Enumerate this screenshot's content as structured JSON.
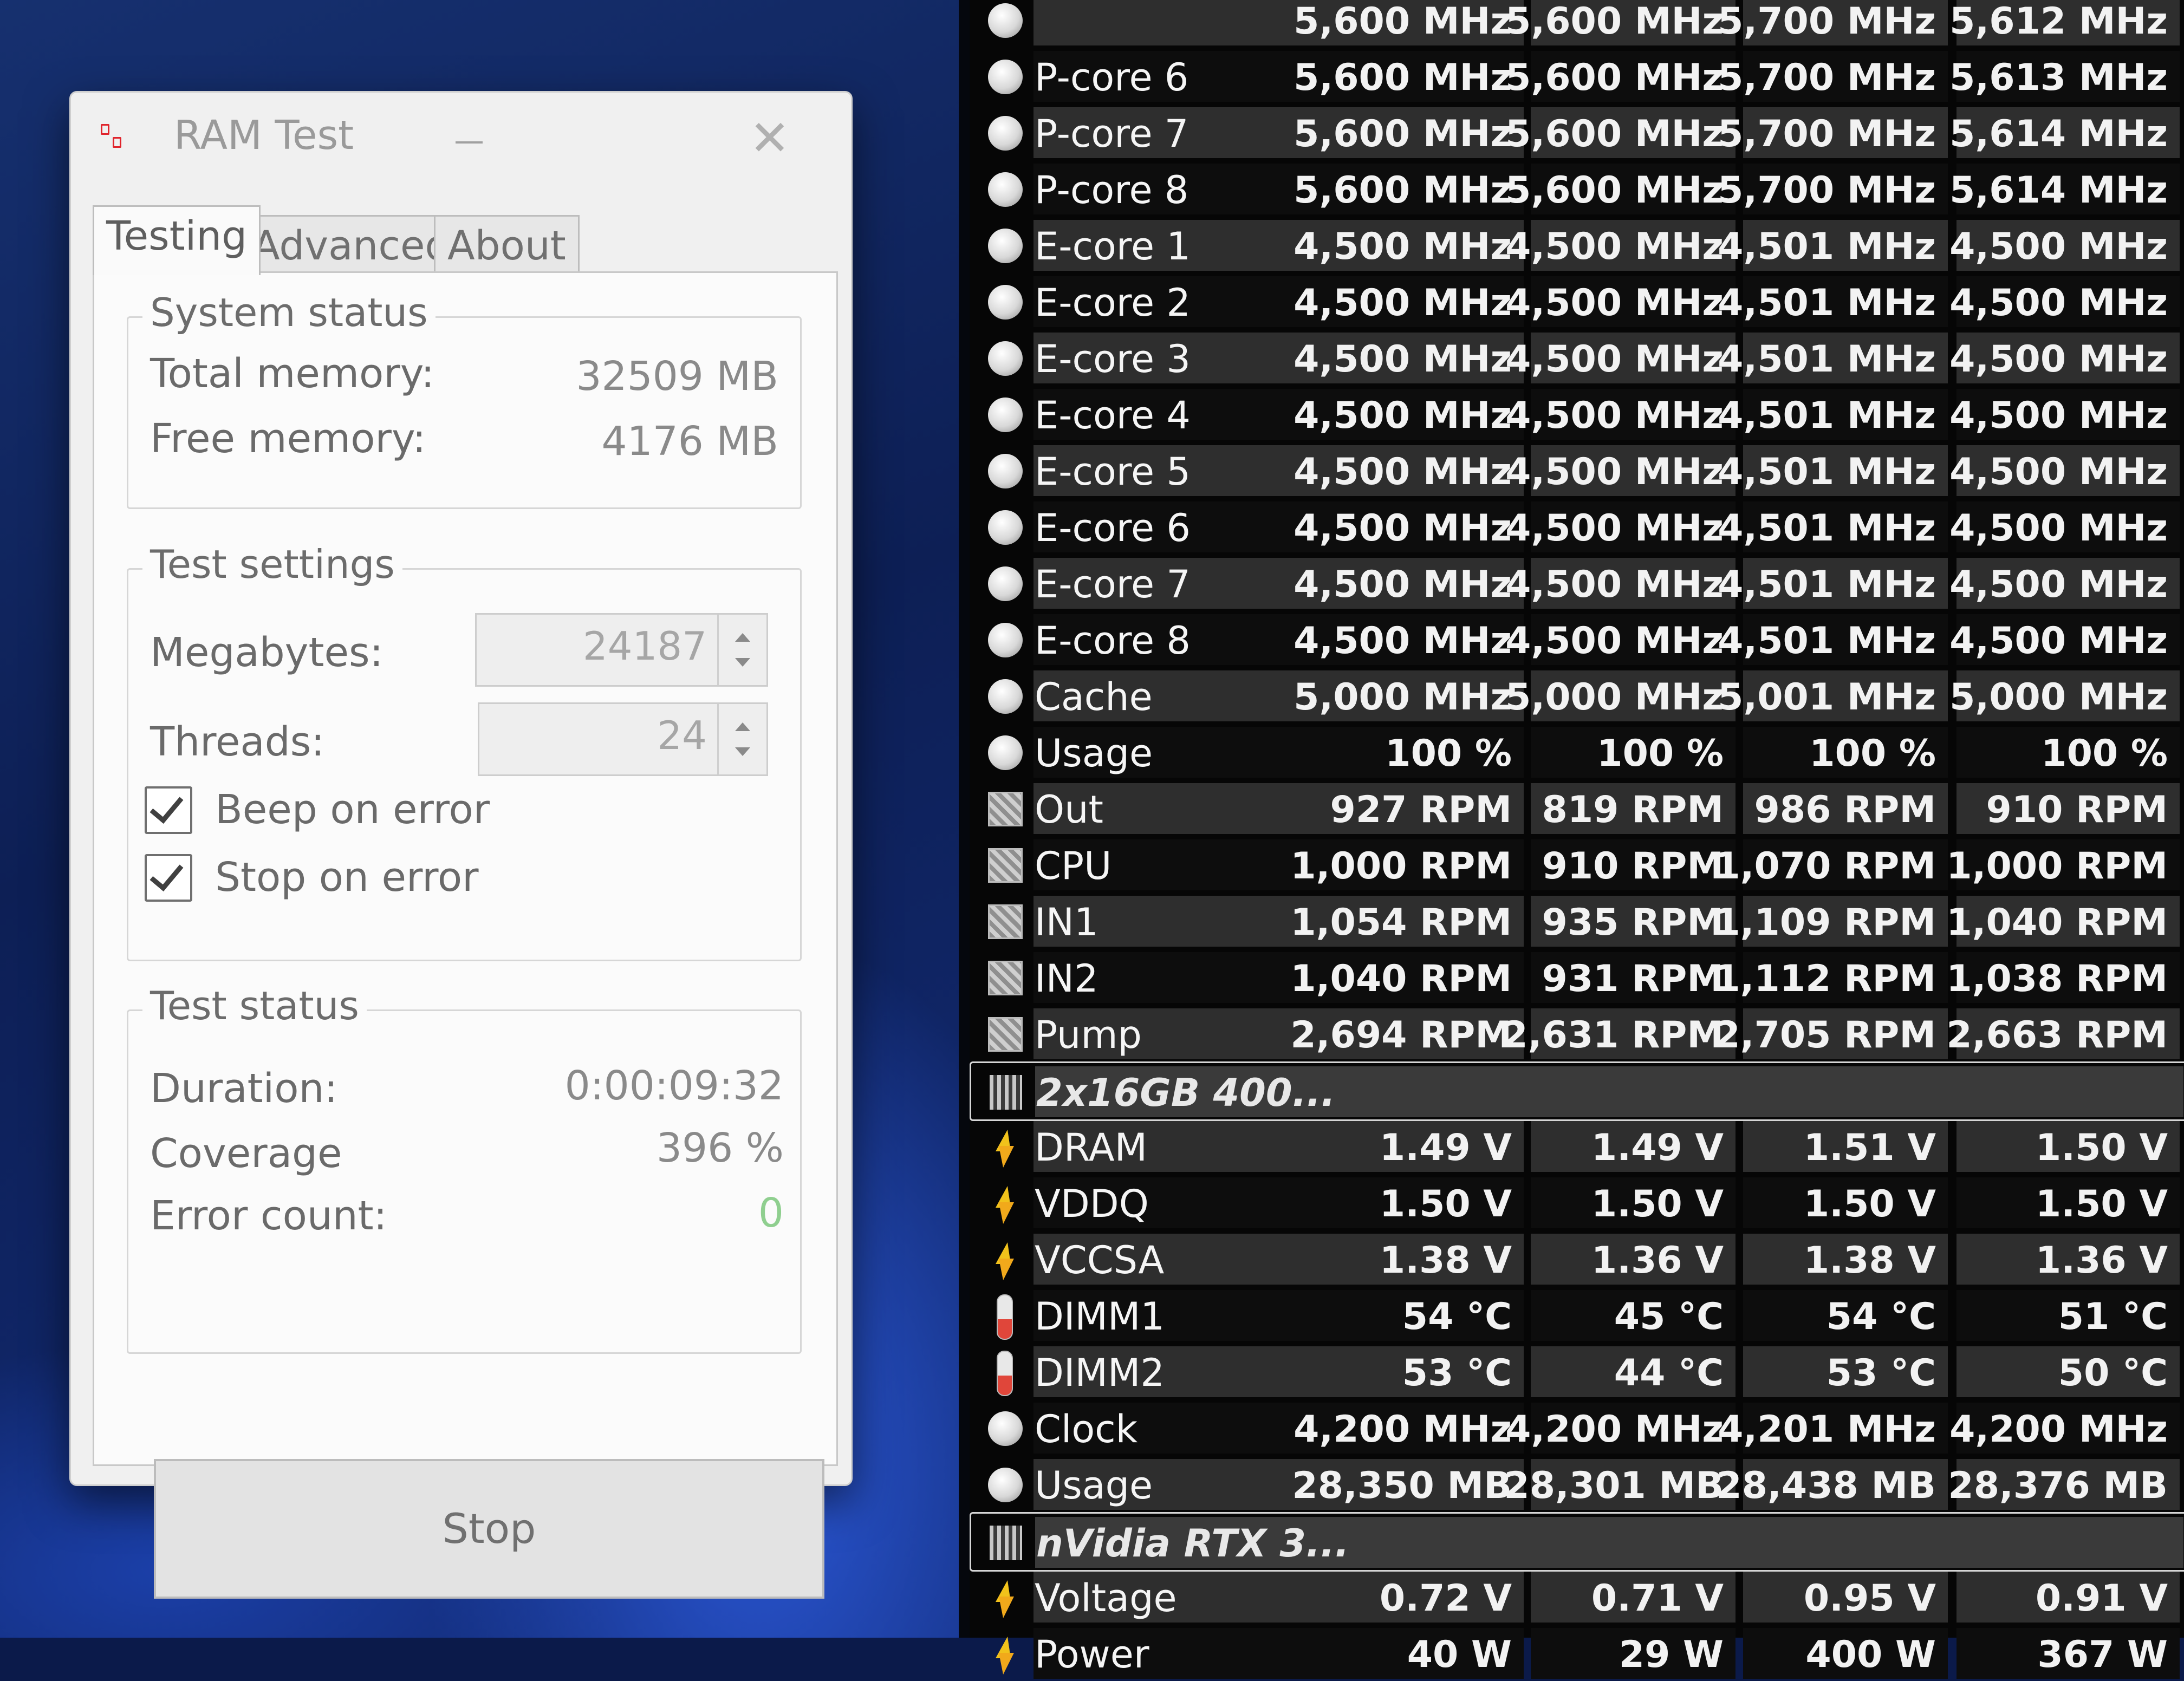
{
  "ramtest": {
    "title": "RAM Test",
    "close_glyph": "✕",
    "tabs": [
      "Testing",
      "Advanced",
      "About"
    ],
    "system_status": {
      "title": "System status",
      "total_label": "Total memory:",
      "total_value": "32509 MB",
      "free_label": "Free memory:",
      "free_value": "4176 MB"
    },
    "test_settings": {
      "title": "Test settings",
      "megabytes_label": "Megabytes:",
      "megabytes_value": "24187",
      "threads_label": "Threads:",
      "threads_value": "24",
      "beep_label": "Beep on error",
      "beep_checked": true,
      "stop_label": "Stop on error",
      "stop_checked": true
    },
    "test_status": {
      "title": "Test status",
      "duration_label": "Duration:",
      "duration_value": "0:00:09:32",
      "coverage_label": "Coverage",
      "coverage_value": "396 %",
      "errors_label": "Error count:",
      "errors_value": "0"
    },
    "stop_button": "Stop",
    "colors": {
      "error_count": "#8fcf8f",
      "close_icon": "#b0b0b0",
      "app_icon": "#e0242c"
    }
  },
  "sensors": {
    "rows": [
      {
        "name": "",
        "icon": "round-icon",
        "v": [
          "5,600 MHz",
          "5,600 MHz",
          "5,700 MHz",
          "5,612 MHz"
        ]
      },
      {
        "name": "P-core 6",
        "icon": "round-icon",
        "v": [
          "5,600 MHz",
          "5,600 MHz",
          "5,700 MHz",
          "5,613 MHz"
        ]
      },
      {
        "name": "P-core 7",
        "icon": "round-icon",
        "v": [
          "5,600 MHz",
          "5,600 MHz",
          "5,700 MHz",
          "5,614 MHz"
        ]
      },
      {
        "name": "P-core 8",
        "icon": "round-icon",
        "v": [
          "5,600 MHz",
          "5,600 MHz",
          "5,700 MHz",
          "5,614 MHz"
        ]
      },
      {
        "name": "E-core 1",
        "icon": "round-icon",
        "v": [
          "4,500 MHz",
          "4,500 MHz",
          "4,501 MHz",
          "4,500 MHz"
        ]
      },
      {
        "name": "E-core 2",
        "icon": "round-icon",
        "v": [
          "4,500 MHz",
          "4,500 MHz",
          "4,501 MHz",
          "4,500 MHz"
        ]
      },
      {
        "name": "E-core 3",
        "icon": "round-icon",
        "v": [
          "4,500 MHz",
          "4,500 MHz",
          "4,501 MHz",
          "4,500 MHz"
        ]
      },
      {
        "name": "E-core 4",
        "icon": "round-icon",
        "v": [
          "4,500 MHz",
          "4,500 MHz",
          "4,501 MHz",
          "4,500 MHz"
        ]
      },
      {
        "name": "E-core 5",
        "icon": "round-icon",
        "v": [
          "4,500 MHz",
          "4,500 MHz",
          "4,501 MHz",
          "4,500 MHz"
        ]
      },
      {
        "name": "E-core 6",
        "icon": "round-icon",
        "v": [
          "4,500 MHz",
          "4,500 MHz",
          "4,501 MHz",
          "4,500 MHz"
        ]
      },
      {
        "name": "E-core 7",
        "icon": "round-icon",
        "v": [
          "4,500 MHz",
          "4,500 MHz",
          "4,501 MHz",
          "4,500 MHz"
        ]
      },
      {
        "name": "E-core 8",
        "icon": "round-icon",
        "v": [
          "4,500 MHz",
          "4,500 MHz",
          "4,501 MHz",
          "4,500 MHz"
        ]
      },
      {
        "name": "Cache",
        "icon": "round-icon",
        "v": [
          "5,000 MHz",
          "5,000 MHz",
          "5,001 MHz",
          "5,000 MHz"
        ]
      },
      {
        "name": "Usage",
        "icon": "round-icon",
        "v": [
          "100 %",
          "100 %",
          "100 %",
          "100 %"
        ]
      },
      {
        "name": "Out",
        "icon": "fan-icon",
        "v": [
          "927 RPM",
          "819 RPM",
          "986 RPM",
          "910 RPM"
        ]
      },
      {
        "name": "CPU",
        "icon": "fan-icon",
        "v": [
          "1,000 RPM",
          "910 RPM",
          "1,070 RPM",
          "1,000 RPM"
        ]
      },
      {
        "name": "IN1",
        "icon": "fan-icon",
        "v": [
          "1,054 RPM",
          "935 RPM",
          "1,109 RPM",
          "1,040 RPM"
        ]
      },
      {
        "name": "IN2",
        "icon": "fan-icon",
        "v": [
          "1,040 RPM",
          "931 RPM",
          "1,112 RPM",
          "1,038 RPM"
        ]
      },
      {
        "name": "Pump",
        "icon": "fan-icon",
        "v": [
          "2,694 RPM",
          "2,631 RPM",
          "2,705 RPM",
          "2,663 RPM"
        ]
      },
      {
        "name": "2x16GB 400...",
        "icon": "chip-icon",
        "group": true,
        "v": [
          "",
          "",
          "",
          ""
        ]
      },
      {
        "name": "DRAM",
        "icon": "bolt-icon",
        "v": [
          "1.49 V",
          "1.49 V",
          "1.51 V",
          "1.50 V"
        ]
      },
      {
        "name": "VDDQ",
        "icon": "bolt-icon",
        "v": [
          "1.50 V",
          "1.50 V",
          "1.50 V",
          "1.50 V"
        ]
      },
      {
        "name": "VCCSA",
        "icon": "bolt-icon",
        "v": [
          "1.38 V",
          "1.36 V",
          "1.38 V",
          "1.36 V"
        ]
      },
      {
        "name": "DIMM1",
        "icon": "thermometer-icon",
        "v": [
          "54 °C",
          "45 °C",
          "54 °C",
          "51 °C"
        ]
      },
      {
        "name": "DIMM2",
        "icon": "thermometer-icon",
        "v": [
          "53 °C",
          "44 °C",
          "53 °C",
          "50 °C"
        ]
      },
      {
        "name": "Clock",
        "icon": "round-icon",
        "v": [
          "4,200 MHz",
          "4,200 MHz",
          "4,201 MHz",
          "4,200 MHz"
        ]
      },
      {
        "name": "Usage",
        "icon": "round-icon",
        "v": [
          "28,350 MB",
          "28,301 MB",
          "28,438 MB",
          "28,376 MB"
        ]
      },
      {
        "name": "nVidia RTX 3...",
        "icon": "chip-icon",
        "group": true,
        "v": [
          "",
          "",
          "",
          ""
        ]
      },
      {
        "name": "Voltage",
        "icon": "bolt-icon",
        "v": [
          "0.72 V",
          "0.71 V",
          "0.95 V",
          "0.91 V"
        ]
      },
      {
        "name": "Power",
        "icon": "bolt-icon",
        "v": [
          "40 W",
          "29 W",
          "400 W",
          "367 W"
        ]
      }
    ]
  }
}
